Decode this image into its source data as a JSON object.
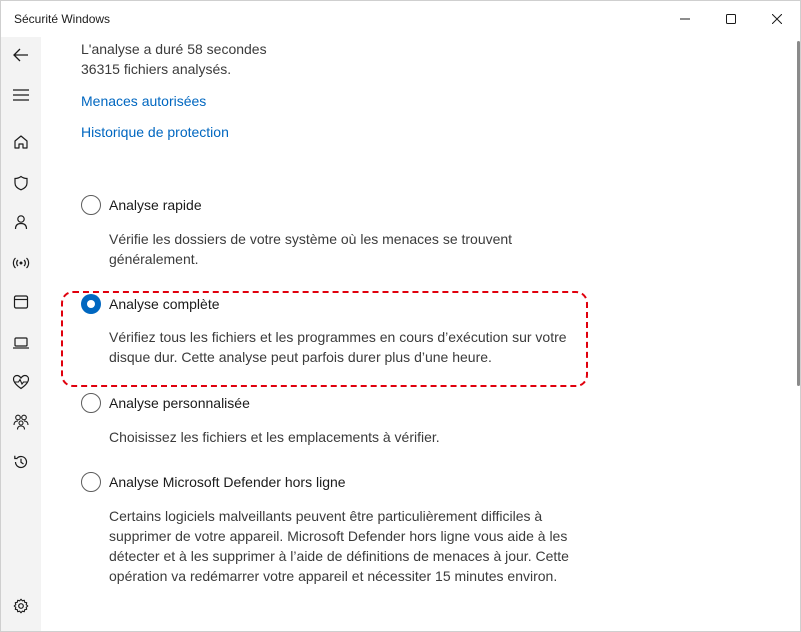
{
  "window": {
    "title": "Sécurité Windows"
  },
  "caption_buttons": [
    "minimize-icon",
    "maximize-icon",
    "close-icon"
  ],
  "nav": {
    "items": [
      "back-arrow-icon",
      "menu-icon",
      "home-icon",
      "shield-icon",
      "account-icon",
      "network-icon",
      "app-browser-icon",
      "device-icon",
      "health-icon",
      "family-icon",
      "history-icon",
      "settings-icon"
    ]
  },
  "scan_info": {
    "duration": "L'analyse a duré 58 secondes",
    "files": "36315 fichiers analysés."
  },
  "links": {
    "allowed_threats": "Menaces autorisées",
    "protection_history": "Historique de protection"
  },
  "options": [
    {
      "label": "Analyse rapide",
      "checked": false,
      "description": "Vérifie les dossiers de votre système où les menaces se trouvent généralement."
    },
    {
      "label": "Analyse complète",
      "checked": true,
      "description": "Vérifiez tous les fichiers et les programmes en cours d’exécution sur votre disque dur. Cette analyse peut parfois durer plus d’une heure."
    },
    {
      "label": "Analyse personnalisée",
      "checked": false,
      "description": "Choisissez les fichiers et les emplacements à vérifier."
    },
    {
      "label": "Analyse Microsoft Defender hors ligne",
      "checked": false,
      "description": "Certains logiciels malveillants peuvent être particulièrement difficiles à supprimer de votre appareil. Microsoft Defender hors ligne vous aide à les détecter et à les supprimer à l’aide de définitions de menaces à jour. Cette opération va redémarrer votre appareil et nécessiter 15 minutes environ."
    }
  ],
  "colors": {
    "accent": "#0067c0",
    "highlight": "#e0000d",
    "nav_background": "#f3f3f3"
  }
}
